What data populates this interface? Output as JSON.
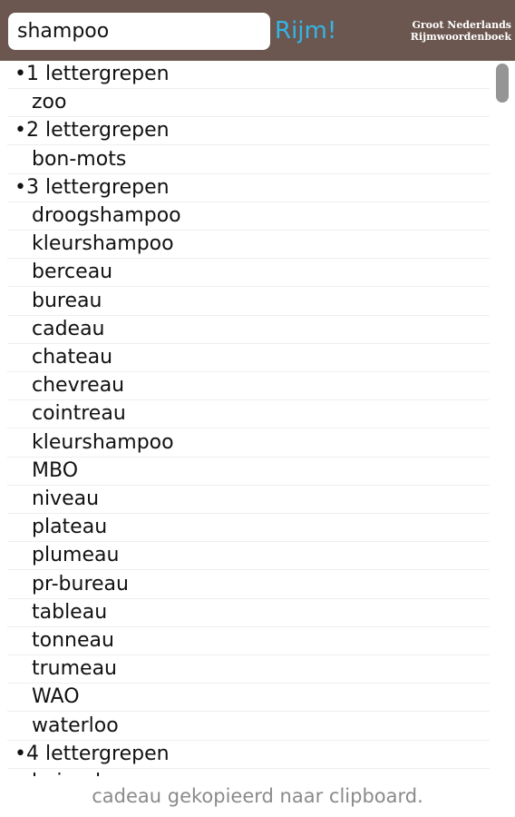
{
  "header": {
    "search_value": "shampoo",
    "rijm_label": "Rijm!",
    "brand_line1": "Groot Nederlands",
    "brand_line2": "Rijmwoordenboek"
  },
  "list": {
    "rows": [
      {
        "type": "header",
        "text": "•1 lettergrepen"
      },
      {
        "type": "word",
        "text": "zoo"
      },
      {
        "type": "header",
        "text": "•2 lettergrepen"
      },
      {
        "type": "word",
        "text": "bon-mots"
      },
      {
        "type": "header",
        "text": "•3 lettergrepen"
      },
      {
        "type": "word",
        "text": "droogshampoo"
      },
      {
        "type": "word",
        "text": "kleurshampoo"
      },
      {
        "type": "word",
        "text": "berceau"
      },
      {
        "type": "word",
        "text": "bureau"
      },
      {
        "type": "word",
        "text": "cadeau"
      },
      {
        "type": "word",
        "text": "chateau"
      },
      {
        "type": "word",
        "text": "chevreau"
      },
      {
        "type": "word",
        "text": "cointreau"
      },
      {
        "type": "word",
        "text": "kleurshampoo"
      },
      {
        "type": "word",
        "text": "MBO"
      },
      {
        "type": "word",
        "text": "niveau"
      },
      {
        "type": "word",
        "text": "plateau"
      },
      {
        "type": "word",
        "text": "plumeau"
      },
      {
        "type": "word",
        "text": "pr-bureau"
      },
      {
        "type": "word",
        "text": "tableau"
      },
      {
        "type": "word",
        "text": "tonneau"
      },
      {
        "type": "word",
        "text": "trumeau"
      },
      {
        "type": "word",
        "text": "WAO"
      },
      {
        "type": "word",
        "text": "waterloo"
      },
      {
        "type": "header",
        "text": "•4 lettergrepen"
      },
      {
        "type": "word",
        "text": "boisseleau"
      }
    ]
  },
  "toast": {
    "message": "cadeau gekopieerd naar clipboard."
  }
}
